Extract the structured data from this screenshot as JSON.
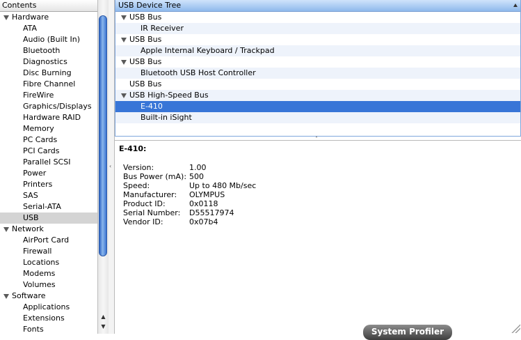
{
  "sidebar": {
    "header": "Contents",
    "categories": [
      {
        "label": "Hardware",
        "items": [
          "ATA",
          "Audio (Built In)",
          "Bluetooth",
          "Diagnostics",
          "Disc Burning",
          "Fibre Channel",
          "FireWire",
          "Graphics/Displays",
          "Hardware RAID",
          "Memory",
          "PC Cards",
          "PCI Cards",
          "Parallel SCSI",
          "Power",
          "Printers",
          "SAS",
          "Serial-ATA",
          "USB"
        ]
      },
      {
        "label": "Network",
        "items": [
          "AirPort Card",
          "Firewall",
          "Locations",
          "Modems",
          "Volumes"
        ]
      },
      {
        "label": "Software",
        "items": [
          "Applications",
          "Extensions",
          "Fonts"
        ]
      }
    ],
    "selected": "USB"
  },
  "device_tree": {
    "header": "USB Device Tree",
    "rows": [
      {
        "type": "bus",
        "label": "USB Bus",
        "expanded": true
      },
      {
        "type": "device",
        "label": "IR Receiver"
      },
      {
        "type": "bus",
        "label": "USB Bus",
        "expanded": true
      },
      {
        "type": "device",
        "label": "Apple Internal Keyboard / Trackpad"
      },
      {
        "type": "bus",
        "label": "USB Bus",
        "expanded": true
      },
      {
        "type": "device",
        "label": "Bluetooth USB Host Controller"
      },
      {
        "type": "bus",
        "label": "USB Bus",
        "expanded": false
      },
      {
        "type": "bus",
        "label": "USB High-Speed Bus",
        "expanded": true
      },
      {
        "type": "device",
        "label": "E-410",
        "selected": true
      },
      {
        "type": "device",
        "label": "Built-in iSight"
      }
    ]
  },
  "detail": {
    "title": "E-410:",
    "properties": [
      {
        "key": "Version:",
        "value": "1.00"
      },
      {
        "key": "Bus Power (mA):",
        "value": "500"
      },
      {
        "key": "Speed:",
        "value": "Up to 480 Mb/sec"
      },
      {
        "key": "Manufacturer:",
        "value": "OLYMPUS"
      },
      {
        "key": "Product ID:",
        "value": "0x0118"
      },
      {
        "key": "Serial Number:",
        "value": "D55517974"
      },
      {
        "key": "Vendor ID:",
        "value": "0x07b4"
      }
    ]
  },
  "app_badge": "System Profiler",
  "colors": {
    "selection_blue": "#3875d7",
    "sidebar_selection": "#d4d4d4",
    "tree_header_blue": "#8fb9ec"
  }
}
